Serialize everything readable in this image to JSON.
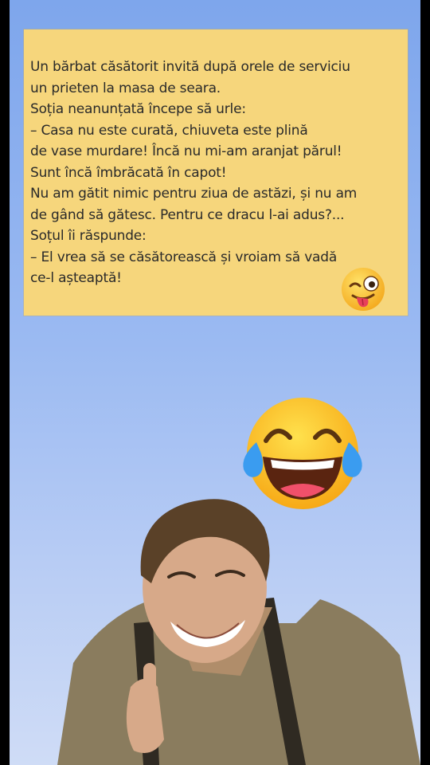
{
  "post": {
    "joke_lines": [
      "Un bărbat căsătorit invită după orele de serviciu",
      "un prieten la masa de seara.",
      "Soția neanunțată începe să urle:",
      "– Casa nu este curată, chiuveta este plină",
      "de vase murdare! Încă nu mi-am aranjat părul!",
      "Sunt încă îmbrăcată în capot!",
      "Nu am gătit nimic pentru ziua de astăzi, și nu am",
      "de gând să gătesc. Pentru ce dracu l-ai adus?...",
      "Soțul îi răspunde:",
      "– El vrea să se căsătorească și vroiam să vadă",
      "ce-l așteaptă!"
    ]
  },
  "icons": {
    "wink": "winking-face-with-tongue-icon",
    "laugh": "face-with-tears-of-joy-icon"
  },
  "colors": {
    "note_background": "#f6d67c",
    "sky_top": "#7ea6ec",
    "sky_bottom": "#cfdcf6",
    "emoji_yellow": "#ffcb2e",
    "tears": "#3a9cf0"
  }
}
